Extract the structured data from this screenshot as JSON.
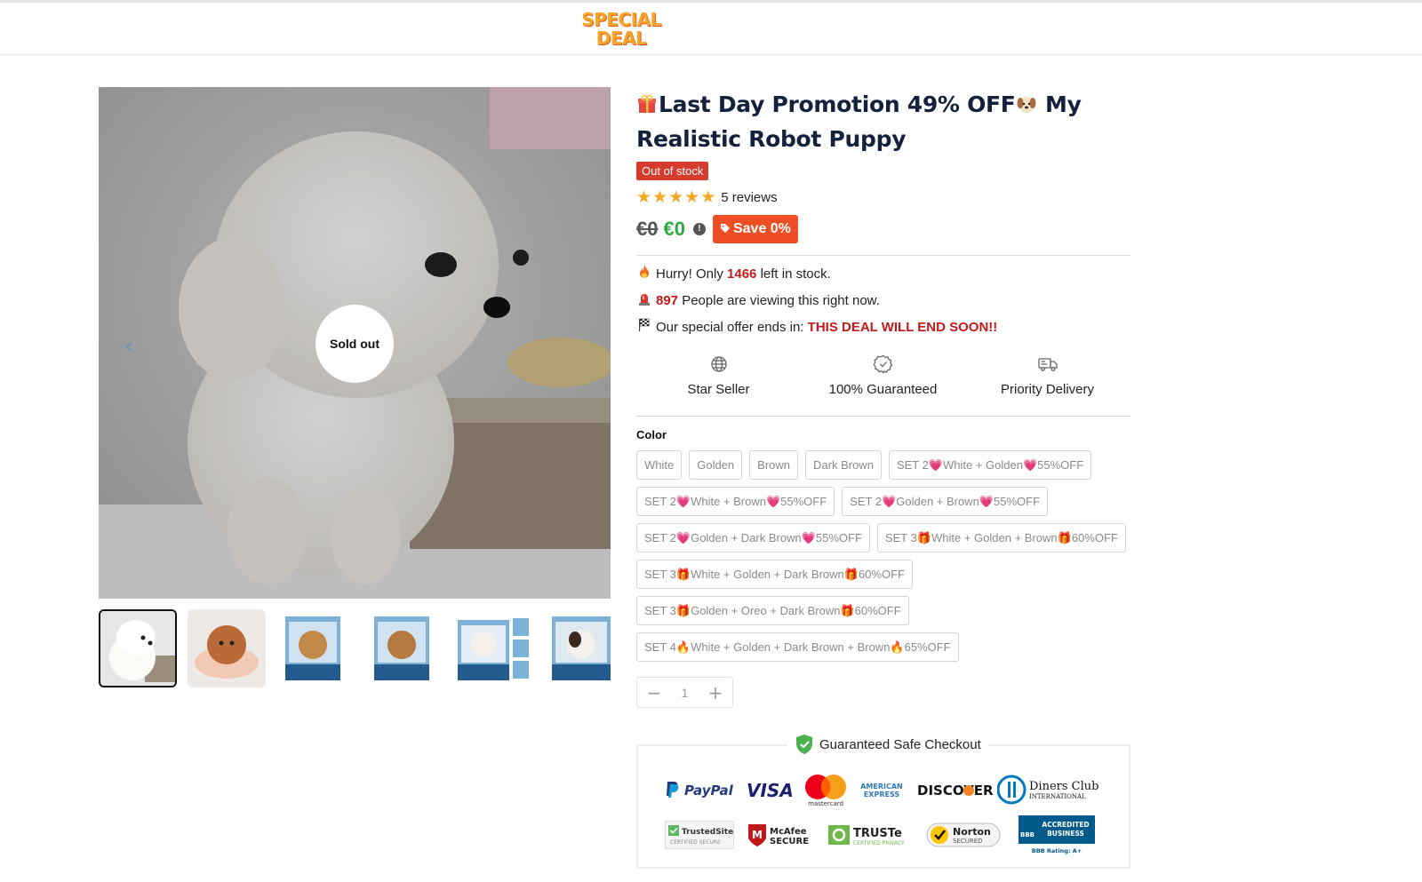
{
  "header": {
    "logo_line1": "SPECIAL",
    "logo_line2": "DEAL"
  },
  "gallery": {
    "sold_out_label": "Sold out",
    "prev_icon": "chevron-left-icon",
    "next_icon": "chevron-right-icon",
    "thumbnail_count": 6
  },
  "product": {
    "title_part1": "Last Day Promotion 49% OFF",
    "title_part2": " My Realistic Robot Puppy",
    "stock_badge": "Out of stock",
    "rating_stars": 5,
    "reviews": "5 reviews",
    "old_price": "€0",
    "new_price": "€0",
    "save_badge": "Save 0%",
    "info_icon": "!"
  },
  "urgency": {
    "stock_prefix": "Hurry! Only ",
    "stock_count": "1466",
    "stock_suffix": " left in stock.",
    "viewers_count": "897",
    "viewers_suffix": " People are viewing this right now.",
    "offer_prefix": "Our special offer ends in: ",
    "offer_value": "THIS DEAL WILL END SOON!!"
  },
  "features": [
    {
      "label": "Star Seller",
      "icon": "globe-icon"
    },
    {
      "label": "100% Guaranteed",
      "icon": "badge-check-icon"
    },
    {
      "label": "Priority Delivery",
      "icon": "truck-icon"
    }
  ],
  "color": {
    "label": "Color",
    "options": [
      "White",
      "Golden",
      "Brown",
      "Dark Brown",
      "SET 2💗White + Golden💗55%OFF",
      "SET 2💗White + Brown💗55%OFF",
      "SET 2💗Golden + Brown💗55%OFF",
      "SET 2💗Golden + Dark Brown💗55%OFF",
      "SET 3🎁White + Golden + Brown🎁60%OFF",
      "SET 3🎁White + Golden + Dark Brown🎁60%OFF",
      "SET 3🎁Golden + Oreo + Dark Brown🎁60%OFF",
      "SET 4🔥White + Golden + Dark Brown + Brown🔥65%OFF"
    ]
  },
  "quantity": {
    "value": "1",
    "minus": "−",
    "plus": "+"
  },
  "checkout": {
    "title": "Guaranteed Safe Checkout",
    "payment_logos": [
      "PayPal",
      "VISA",
      "mastercard",
      "AMERICAN EXPRESS",
      "DISCOVER",
      "Diners Club INTERNATIONAL"
    ],
    "trust_logos": [
      "TrustedSite CERTIFIED SECURE",
      "McAfee SECURE",
      "TRUSTe CERTIFIED PRIVACY",
      "Norton SECURED",
      "ACCREDITED BUSINESS BBB Rating: A+"
    ]
  },
  "colors": {
    "accent_red": "#d63b2e",
    "save_orange": "#ee4e24",
    "price_green": "#2bab43",
    "star": "#f5a623"
  }
}
